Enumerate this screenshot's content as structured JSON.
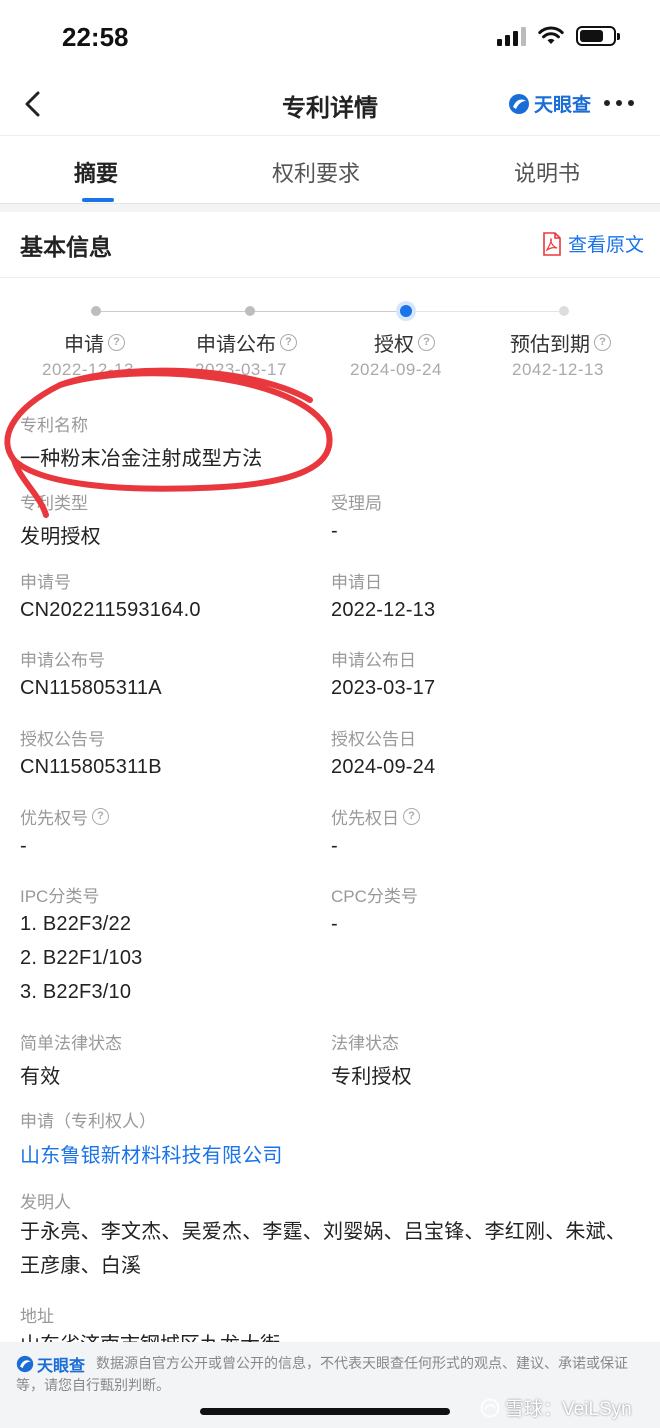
{
  "status_bar": {
    "time": "22:58"
  },
  "nav": {
    "title": "专利详情",
    "brand": "天眼查"
  },
  "tabs": [
    {
      "label": "摘要",
      "active": true
    },
    {
      "label": "权利要求",
      "active": false
    },
    {
      "label": "说明书",
      "active": false
    }
  ],
  "section": {
    "title": "基本信息",
    "view_original": "查看原文"
  },
  "timeline": [
    {
      "label": "申请",
      "date": "2022-12-13",
      "state": "done"
    },
    {
      "label": "申请公布",
      "date": "2023-03-17",
      "state": "done"
    },
    {
      "label": "授权",
      "date": "2024-09-24",
      "state": "current"
    },
    {
      "label": "预估到期",
      "date": "2042-12-13",
      "state": "future"
    }
  ],
  "fields": {
    "patent_name": {
      "label": "专利名称",
      "value": "一种粉末冶金注射成型方法"
    },
    "patent_type": {
      "label": "专利类型",
      "value": "发明授权"
    },
    "office": {
      "label": "受理局",
      "value": "-"
    },
    "app_no": {
      "label": "申请号",
      "value": "CN202211593164.0"
    },
    "app_date": {
      "label": "申请日",
      "value": "2022-12-13"
    },
    "pub_no": {
      "label": "申请公布号",
      "value": "CN115805311A"
    },
    "pub_date": {
      "label": "申请公布日",
      "value": "2023-03-17"
    },
    "grant_no": {
      "label": "授权公告号",
      "value": "CN115805311B"
    },
    "grant_date": {
      "label": "授权公告日",
      "value": "2024-09-24"
    },
    "priority_no": {
      "label": "优先权号",
      "value": "-"
    },
    "priority_date": {
      "label": "优先权日",
      "value": "-"
    },
    "ipc": {
      "label": "IPC分类号",
      "values": [
        "1. B22F3/22",
        "2. B22F1/103",
        "3. B22F3/10"
      ]
    },
    "cpc": {
      "label": "CPC分类号",
      "value": "-"
    },
    "simple_status": {
      "label": "简单法律状态",
      "value": "有效"
    },
    "legal_status": {
      "label": "法律状态",
      "value": "专利授权"
    },
    "applicant": {
      "label": "申请（专利权人）",
      "value": "山东鲁银新材料科技有限公司"
    },
    "inventors": {
      "label": "发明人",
      "value": "于永亮、李文杰、吴爱杰、李霆、刘婴娲、吕宝锋、李红刚、朱斌、王彦康、白溪"
    },
    "address": {
      "label": "地址",
      "value": "山东省济南市钢城区九龙大街"
    }
  },
  "footer": {
    "brand": "天眼查",
    "disclaimer": "数据源自官方公开或曾公开的信息，不代表天眼查任何形式的观点、建议、承诺或保证等，请您自行甄别判断。"
  },
  "watermark": "雪球：VeiLSyn",
  "colors": {
    "accent": "#1a73e8",
    "annotation": "#e8383d"
  }
}
